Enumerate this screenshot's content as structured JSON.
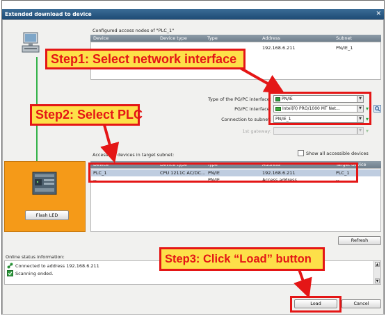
{
  "window": {
    "title": "Extended download to device",
    "cut_text": "",
    "close_glyph": "✕"
  },
  "configured": {
    "label": "Configured access nodes of \"PLC_1\"",
    "columns": [
      "Device",
      "Device type",
      "Type",
      "Address",
      "Subnet"
    ],
    "rows": [
      {
        "address": "192.168.6.211",
        "subnet": "PN/IE_1"
      }
    ]
  },
  "interface": {
    "type_label": "Type of the PG/PC interface:",
    "type_value": "PN/IE",
    "pgpc_label": "PG/PC interface:",
    "pgpc_value": "Intel(R) PRO/1000 MT Net...",
    "subnet_label": "Connection to subnet:",
    "subnet_value": "PN/IE_1",
    "gateway_label": "1st gateway:",
    "gateway_value": ""
  },
  "accessible": {
    "label": "Accessible devices in target subnet:",
    "show_all_label": "Show all accessible devices",
    "show_all_checked": false,
    "columns": [
      "Device",
      "Device type",
      "Type",
      "Address",
      "Target device"
    ],
    "rows": [
      {
        "device": "PLC_1",
        "device_type": "CPU 1211C AC/DC...",
        "type": "PN/IE",
        "address": "192.168.6.211",
        "target": "PLC_1"
      },
      {
        "device": "--",
        "device_type": "",
        "type": "PN/IE",
        "address": "Access address",
        "target": "--"
      }
    ]
  },
  "flash_button": "Flash LED",
  "refresh_button": "Refresh",
  "status": {
    "label": "Online status information:",
    "lines": [
      {
        "icon": "link-icon",
        "text": "Connected to address 192.168.6.211"
      },
      {
        "icon": "check-icon",
        "text": "Scanning ended."
      }
    ]
  },
  "buttons": {
    "load": "Load",
    "cancel": "Cancel"
  },
  "callouts": {
    "step1": "Step1: Select network interface",
    "step2": "Step2: Select PLC",
    "step3": "Step3: Click “Load” button"
  },
  "colors": {
    "accent_red": "#e41616",
    "callout_fill": "#fde049",
    "device_panel": "#f59a18",
    "title_bar": "#2b5a84"
  }
}
